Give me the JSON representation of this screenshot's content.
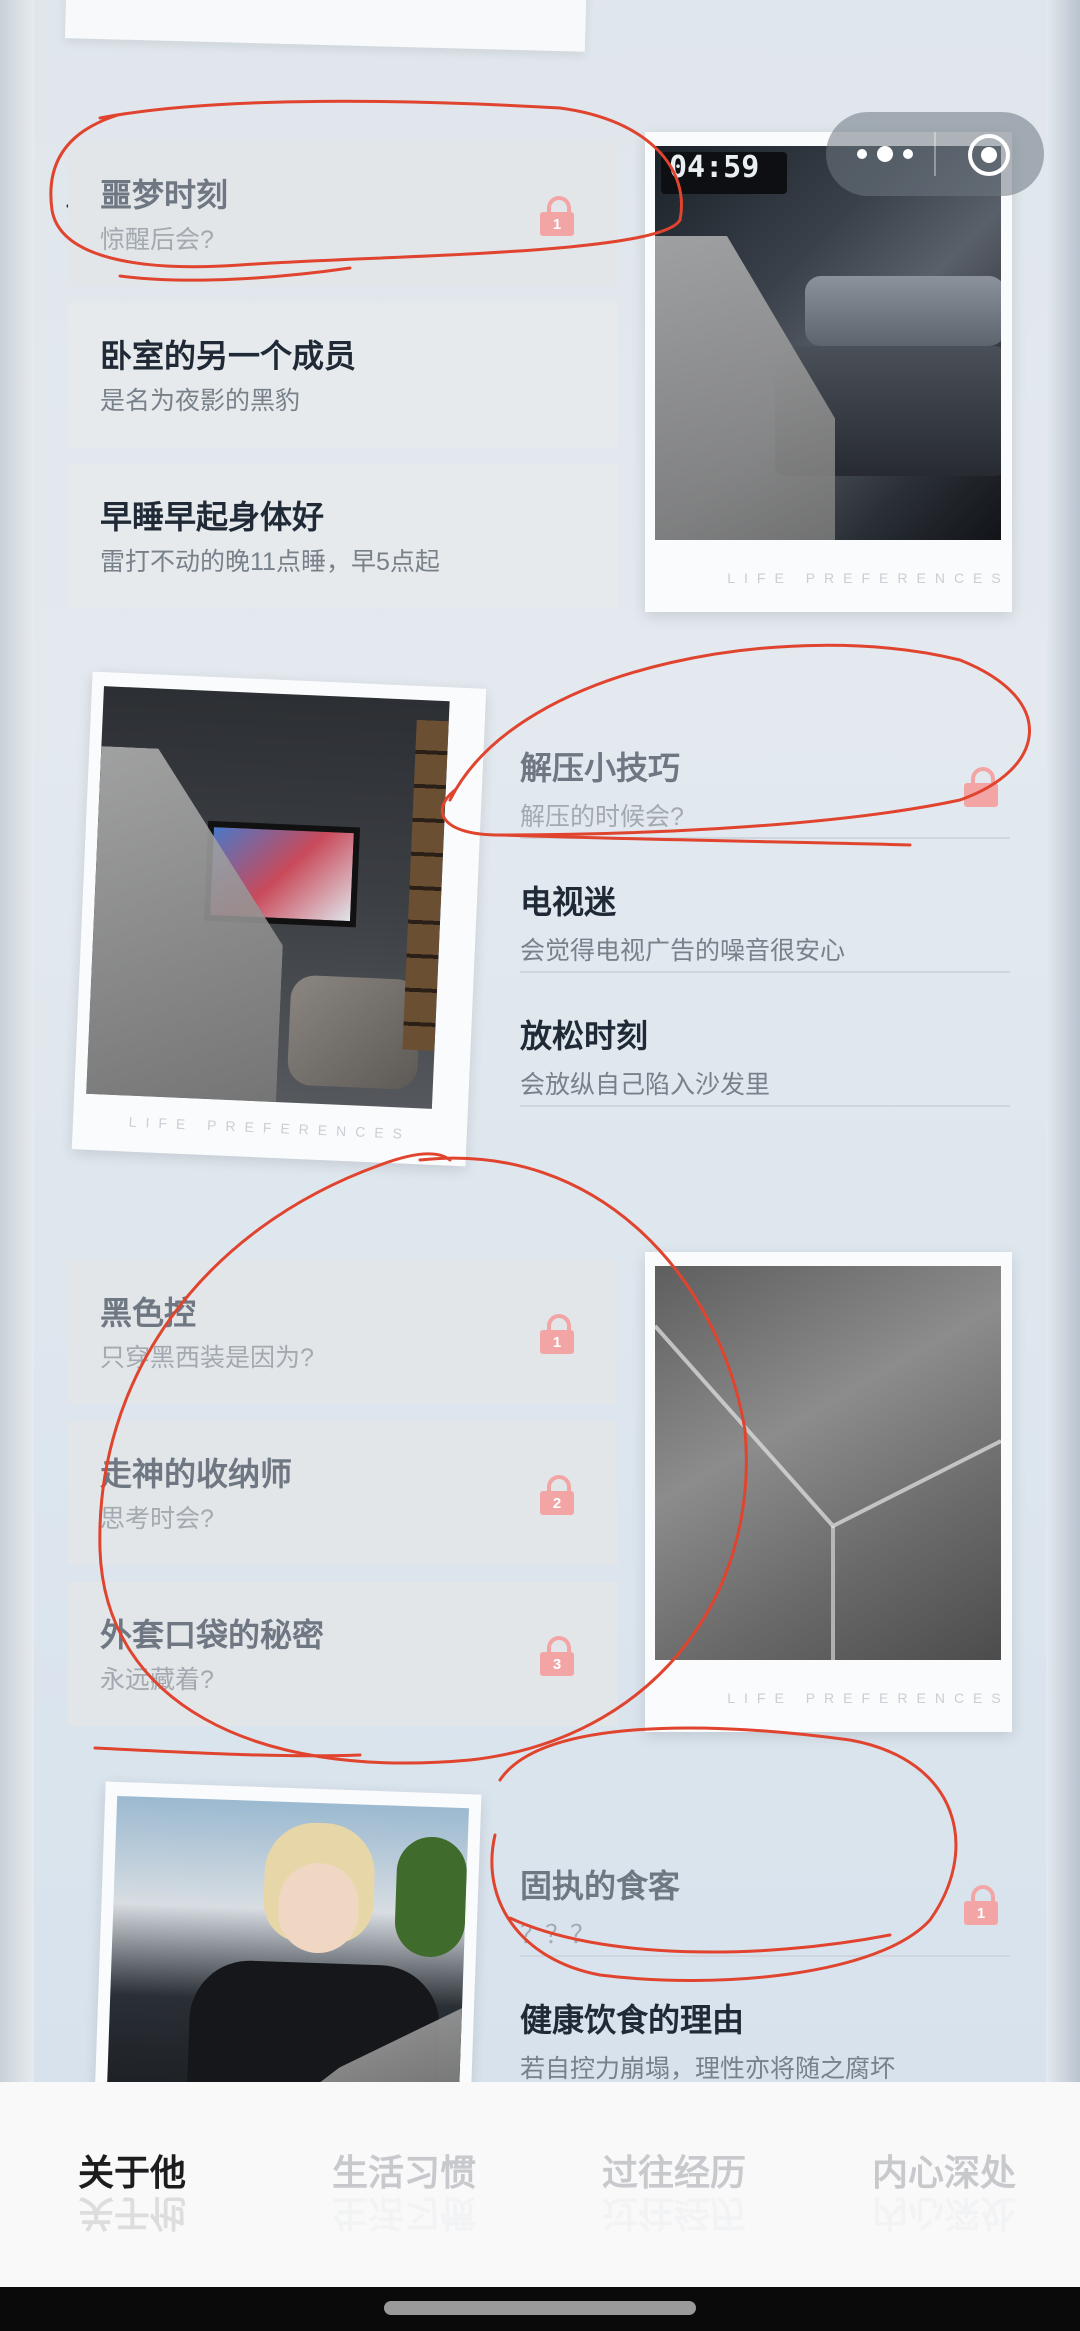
{
  "top_group": {
    "items": [
      {
        "title": "噩梦时刻",
        "subtitle": "惊醒后会?",
        "locked": true,
        "lock_number": "1"
      },
      {
        "title": "卧室的另一个成员",
        "subtitle": "是名为夜影的黑豹",
        "locked": false
      },
      {
        "title": "早睡早起身体好",
        "subtitle": "雷打不动的晚11点睡，早5点起",
        "locked": false
      }
    ],
    "photo_clock": "04:59",
    "photo_caption": "LIFE PREFERENCES"
  },
  "second_group": {
    "items": [
      {
        "title": "解压小技巧",
        "subtitle": "解压的时候会?",
        "locked": true
      },
      {
        "title": "电视迷",
        "subtitle": "会觉得电视广告的噪音很安心",
        "locked": false
      },
      {
        "title": "放松时刻",
        "subtitle": "会放纵自己陷入沙发里",
        "locked": false
      }
    ],
    "photo_caption": "LIFE PREFERENCES"
  },
  "third_group": {
    "items": [
      {
        "title": "黑色控",
        "subtitle": "只穿黑西装是因为?",
        "locked": true,
        "lock_number": "1"
      },
      {
        "title": "走神的收纳师",
        "subtitle": "思考时会?",
        "locked": true,
        "lock_number": "2"
      },
      {
        "title": "外套口袋的秘密",
        "subtitle": "永远藏着?",
        "locked": true,
        "lock_number": "3"
      }
    ],
    "photo_caption": "LIFE PREFERENCES"
  },
  "fourth_group": {
    "items": [
      {
        "title": "固执的食客",
        "subtitle": "？？？",
        "locked": true,
        "lock_number": "1"
      },
      {
        "title": "健康饮食的理由",
        "subtitle": "若自控力崩塌，理性亦将随之腐坏",
        "locked": false
      }
    ]
  },
  "bottom_nav": {
    "tabs": [
      {
        "label": "关于他",
        "active": true
      },
      {
        "label": "生活习惯",
        "active": false
      },
      {
        "label": "过往经历",
        "active": false
      },
      {
        "label": "内心深处",
        "active": false
      }
    ]
  },
  "colors": {
    "lock": "#f3a5a6",
    "annotation": "#e0442f",
    "active_tab": "#1d1d1f",
    "inactive_tab": "#c7c9cc"
  }
}
